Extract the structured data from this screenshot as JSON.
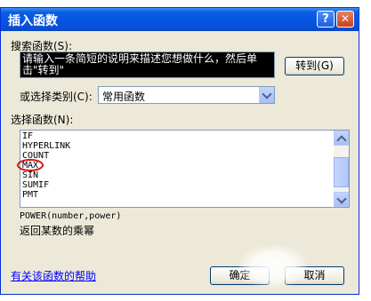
{
  "window": {
    "title": "插入函数",
    "help_glyph": "?",
    "close_glyph": "✕"
  },
  "search": {
    "label": "搜索函数(S):",
    "value": "请输入一条简短的说明来描述您想做什么，然后单击\"转到\"",
    "go_label": "转到(G)"
  },
  "category": {
    "label": "或选择类别(C):",
    "selected": "常用函数"
  },
  "functions": {
    "label": "选择函数(N):",
    "items": [
      "IF",
      "HYPERLINK",
      "COUNT",
      "MAX",
      "SIN",
      "SUMIF",
      "PMT"
    ]
  },
  "description": {
    "syntax": "POWER(number,power)",
    "text": "返回某数的乘幂"
  },
  "footer": {
    "help_link": "有关该函数的帮助",
    "ok_label": "确定",
    "cancel_label": "取消"
  }
}
